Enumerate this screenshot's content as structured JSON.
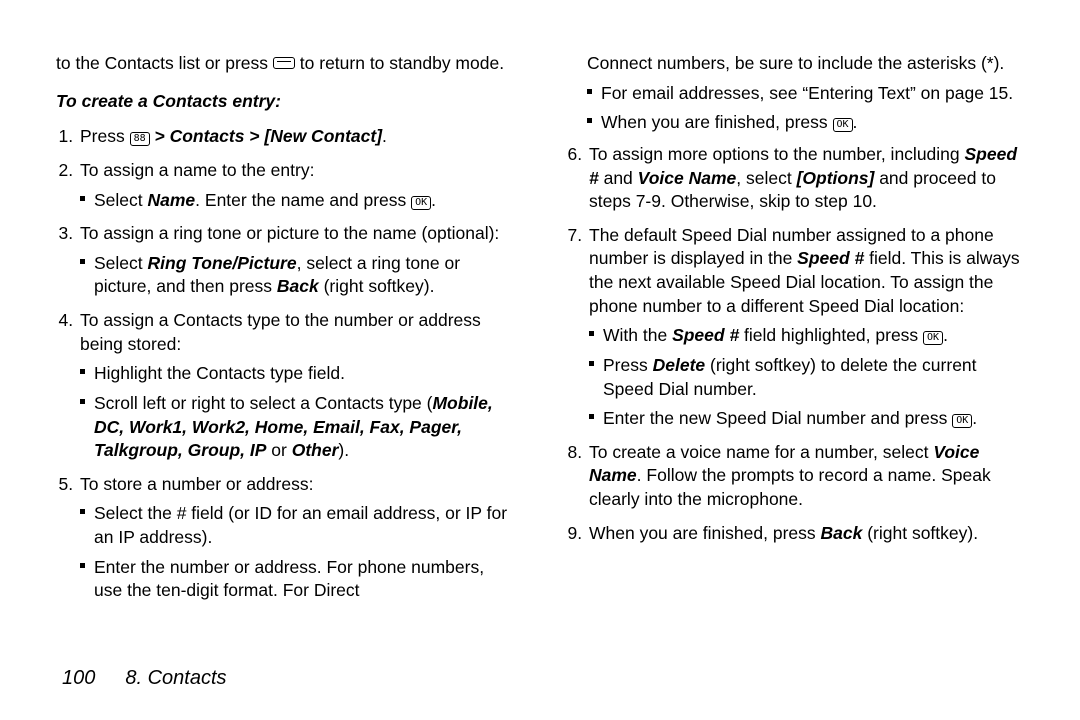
{
  "col1": {
    "topline_a": "to the Contacts list or press ",
    "topline_b": " to return to standby mode.",
    "heading": "To create a Contacts entry:",
    "s1_a": "Press ",
    "s1_b": " > Contacts > [New Contact]",
    "s1_c": ".",
    "s2": "To assign a name to the entry:",
    "s2b_a": "Select ",
    "s2b_name": "Name",
    "s2b_b": ". Enter the name and press ",
    "s2b_c": ".",
    "s3": "To assign a ring tone or picture to the name (optional):",
    "s3b_a": "Select ",
    "s3b_rt": "Ring Tone/Picture",
    "s3b_b": ", select a ring tone or picture, and then press ",
    "s3b_back": "Back",
    "s3b_c": " (right softkey).",
    "s4": "To assign a Contacts type to the number or address being stored:",
    "s4b1": "Highlight the Contacts type field.",
    "s4b2_a": "Scroll left or right to select a Contacts type (",
    "s4b2_types": "Mobile, DC, Work1, Work2, Home, Email, Fax, Pager, Talkgroup, Group, IP",
    "s4b2_b": " or ",
    "s4b2_other": "Other",
    "s4b2_c": ").",
    "s5": "To store a number or address:",
    "s5b1": "Select the # field (or ID for an email address, or IP for an IP address).",
    "s5b2": "Enter the number or address. For phone numbers, use the ten-digit format. For Direct"
  },
  "col2": {
    "s5b3": "Connect numbers, be sure to include the asterisks (*).",
    "s5b4": "For email addresses, see “Entering Text” on page 15.",
    "s5b5_a": "When you are finished, press ",
    "s5b5_b": ".",
    "s6_a": "To assign more options to the number, including ",
    "s6_speed": "Speed #",
    "s6_b": " and ",
    "s6_vn": "Voice Name",
    "s6_c": ", select ",
    "s6_opt": "[Options]",
    "s6_d": " and proceed to steps 7-9. Otherwise, skip to step 10.",
    "s7_a": "The default Speed Dial number assigned to a phone number is displayed in the ",
    "s7_speed": "Speed #",
    "s7_b": " field. This is always the next available Speed Dial location. To assign the phone number to a different Speed Dial location:",
    "s7b1_a": "With the ",
    "s7b1_speed": "Speed #",
    "s7b1_b": " field highlighted, press ",
    "s7b1_c": ".",
    "s7b2_a": "Press ",
    "s7b2_del": "Delete",
    "s7b2_b": " (right softkey) to delete the current Speed Dial number.",
    "s7b3_a": "Enter the new Speed Dial number and press ",
    "s7b3_b": ".",
    "s8_a": "To create a voice name for a number, select ",
    "s8_vn": "Voice Name",
    "s8_b": ". Follow the prompts to record a name. Speak clearly into the microphone.",
    "s9_a": "When you are finished, press ",
    "s9_back": "Back",
    "s9_b": " (right softkey)."
  },
  "footer": {
    "page": "100",
    "section": "8. Contacts"
  },
  "keys": {
    "menu": "88",
    "ok": "OK"
  }
}
